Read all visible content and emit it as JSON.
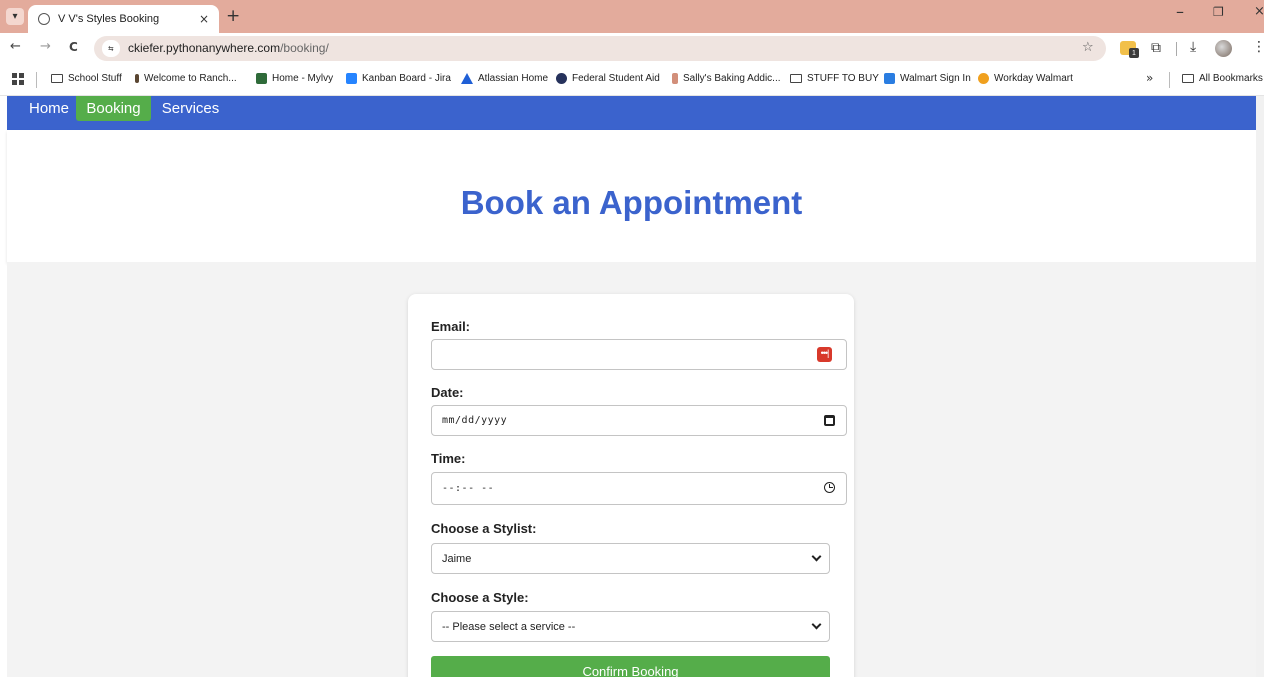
{
  "browser": {
    "tab": {
      "title": "V V's Styles Booking",
      "close_glyph": "×"
    },
    "new_tab_glyph": "+",
    "window": {
      "minimize_glyph": "–",
      "restore_glyph": "❐",
      "close_glyph": "×"
    },
    "nav": {
      "back_glyph": "←",
      "forward_glyph": "→",
      "reload_glyph": "C"
    },
    "url": {
      "host": "ckiefer.pythonanywhere.com",
      "path": "/booking/"
    },
    "star_glyph": "☆",
    "extension_badge": "1",
    "bookmarks": [
      {
        "label": "School Stuff",
        "icon": "folder-icon",
        "color": "#444444"
      },
      {
        "label": "Welcome to Ranch...",
        "icon": "ranch-favicon",
        "color": "#5a4632"
      },
      {
        "label": "Home - Mylvy",
        "icon": "mylvy-favicon",
        "color": "#2f6b3a"
      },
      {
        "label": "Kanban Board - Jira",
        "icon": "jira-favicon",
        "color": "#2684ff"
      },
      {
        "label": "Atlassian Home",
        "icon": "atlassian-favicon",
        "color": "#1f5fd6"
      },
      {
        "label": "Federal Student Aid",
        "icon": "fsa-favicon",
        "color": "#26325c"
      },
      {
        "label": "Sally's Baking Addic...",
        "icon": "sallys-favicon",
        "color": "#d28f7a"
      },
      {
        "label": "STUFF TO BUY",
        "icon": "folder-icon",
        "color": "#444444"
      },
      {
        "label": "Walmart Sign In",
        "icon": "walmart-favicon",
        "color": "#2a7de1"
      },
      {
        "label": "Workday Walmart",
        "icon": "workday-favicon",
        "color": "#f0a01e"
      }
    ],
    "more_bookmarks_glyph": "»",
    "all_bookmarks": "All Bookmarks"
  },
  "site_nav": {
    "items": [
      {
        "label": "Home",
        "active": false
      },
      {
        "label": "Booking",
        "active": true
      },
      {
        "label": "Services",
        "active": false
      }
    ]
  },
  "page": {
    "title": "Book an Appointment"
  },
  "form": {
    "email": {
      "label": "Email:",
      "value": ""
    },
    "date": {
      "label": "Date:",
      "placeholder": "mm/dd/yyyy"
    },
    "time": {
      "label": "Time:",
      "placeholder": "--:-- --"
    },
    "stylist": {
      "label": "Choose a Stylist:",
      "selected": "Jaime"
    },
    "style": {
      "label": "Choose a Style:",
      "selected": "-- Please select a service --"
    },
    "password_manager_glyph": "•••|",
    "submit_label": "Confirm Booking"
  },
  "colors": {
    "brand_blue": "#3b63cd",
    "active_green": "#55ad4a",
    "tabstrip": "#e3ab9c",
    "password_icon": "#d8392b"
  }
}
